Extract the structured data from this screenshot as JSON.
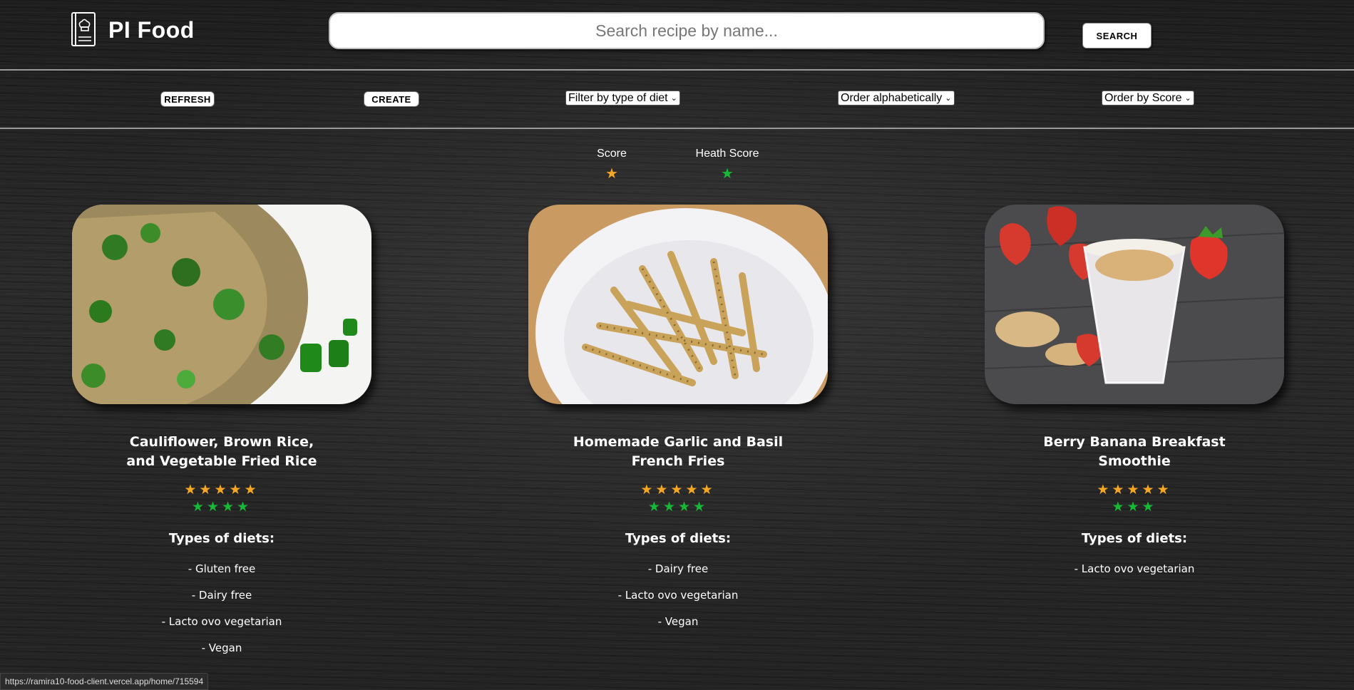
{
  "header": {
    "app_title": "PI Food",
    "search_placeholder": "Search recipe by name...",
    "search_label": "SEARCH"
  },
  "filters": {
    "refresh_label": "REFRESH",
    "create_label": "CREATE",
    "diet_select": "Filter by type of diet",
    "alpha_select": "Order alphabetically",
    "score_select": "Order by Score"
  },
  "legend": {
    "score_label": "Score",
    "health_label": "Heath Score",
    "score_color": "#f5a623",
    "health_color": "#16b835"
  },
  "diet_heading": "Types of diets:",
  "cards": [
    {
      "title": "Cauliflower, Brown Rice, and Vegetable Fried Rice",
      "score_stars": 5,
      "health_stars": 4,
      "diets": [
        "- Gluten free",
        "- Dairy free",
        "- Lacto ovo vegetarian",
        "- Vegan"
      ]
    },
    {
      "title": "Homemade Garlic and Basil French Fries",
      "score_stars": 5,
      "health_stars": 4,
      "diets": [
        "- Dairy free",
        "- Lacto ovo vegetarian",
        "- Vegan"
      ]
    },
    {
      "title": "Berry Banana Breakfast Smoothie",
      "score_stars": 5,
      "health_stars": 3,
      "diets": [
        "- Lacto ovo vegetarian"
      ]
    }
  ],
  "status_bar": {
    "url": "https://ramira10-food-client.vercel.app/home/715594"
  }
}
